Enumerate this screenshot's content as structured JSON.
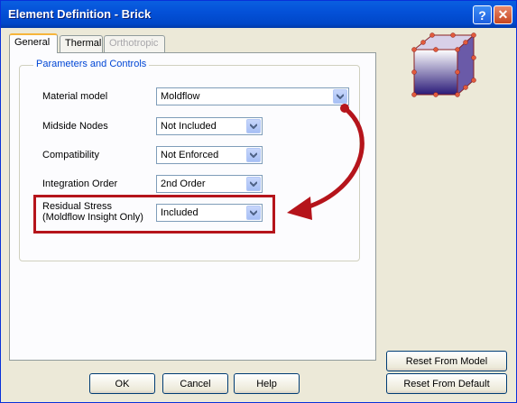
{
  "window": {
    "title": "Element Definition - Brick"
  },
  "tabs": [
    {
      "label": "General",
      "state": "active"
    },
    {
      "label": "Thermal",
      "state": "normal"
    },
    {
      "label": "Orthotropic",
      "state": "disabled"
    }
  ],
  "group": {
    "title": "Parameters and Controls"
  },
  "fields": {
    "material_model": {
      "label": "Material model",
      "value": "Moldflow"
    },
    "midside_nodes": {
      "label": "Midside Nodes",
      "value": "Not Included"
    },
    "compatibility": {
      "label": "Compatibility",
      "value": "Not Enforced"
    },
    "integration_order": {
      "label": "Integration Order",
      "value": "2nd Order"
    },
    "residual_stress": {
      "label_line1": "Residual Stress",
      "label_line2": "(Moldflow Insight Only)",
      "value": "Included"
    }
  },
  "buttons": {
    "ok": "OK",
    "cancel": "Cancel",
    "help": "Help",
    "reset_model": "Reset From Model",
    "reset_default": "Reset From Default"
  },
  "colors": {
    "accent": "#0046d5",
    "highlight": "#b5141b",
    "titlebar": "#0451d8"
  }
}
